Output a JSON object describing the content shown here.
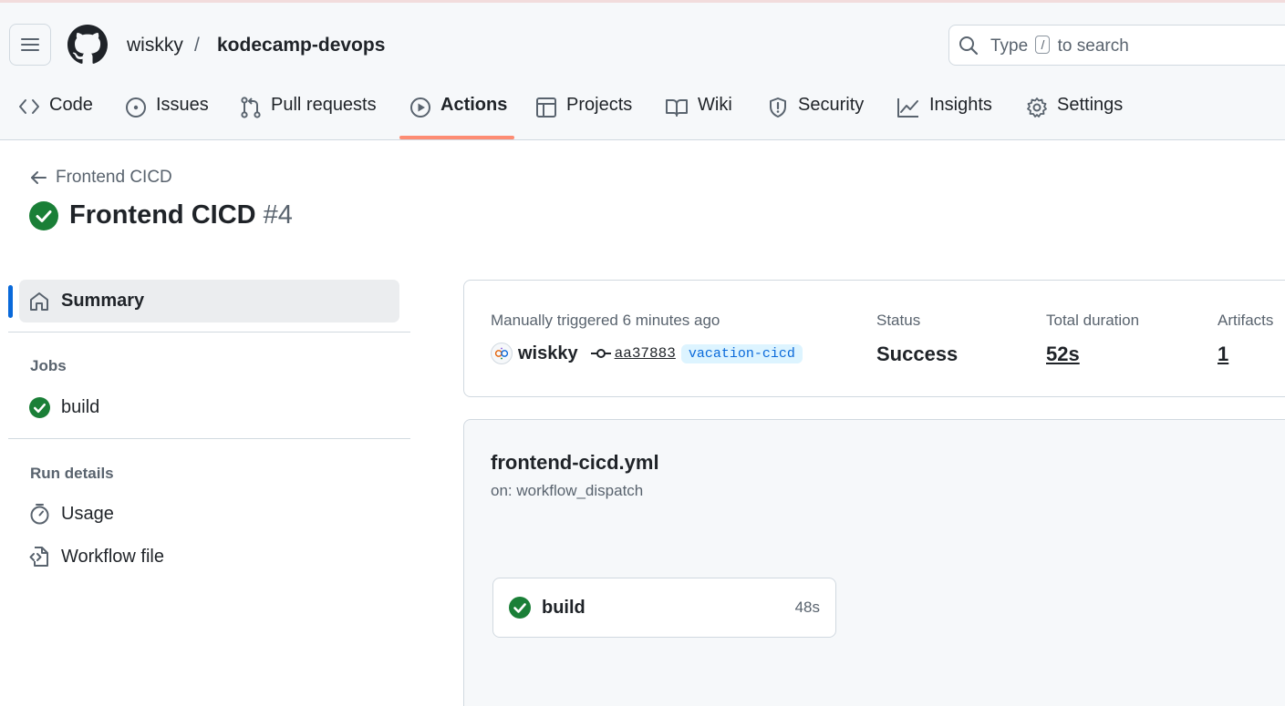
{
  "header": {
    "owner": "wiskky",
    "separator": "/",
    "repo": "kodecamp-devops",
    "search": {
      "prefix": "Type",
      "key": "/",
      "suffix": "to search"
    }
  },
  "tabs": [
    {
      "label": "Code",
      "icon": "code-icon"
    },
    {
      "label": "Issues",
      "icon": "issue-icon"
    },
    {
      "label": "Pull requests",
      "icon": "pull-request-icon"
    },
    {
      "label": "Actions",
      "icon": "play-icon",
      "active": true
    },
    {
      "label": "Projects",
      "icon": "table-icon"
    },
    {
      "label": "Wiki",
      "icon": "book-icon"
    },
    {
      "label": "Security",
      "icon": "shield-icon"
    },
    {
      "label": "Insights",
      "icon": "graph-icon"
    },
    {
      "label": "Settings",
      "icon": "gear-icon"
    }
  ],
  "run": {
    "back_label": "Frontend CICD",
    "title": "Frontend CICD",
    "number": "#4",
    "status_icon": "check-circle-icon"
  },
  "sidebar": {
    "summary_label": "Summary",
    "jobs_heading": "Jobs",
    "jobs": [
      {
        "label": "build",
        "status": "success"
      }
    ],
    "run_details_heading": "Run details",
    "details": [
      {
        "label": "Usage",
        "icon": "stopwatch-icon"
      },
      {
        "label": "Workflow file",
        "icon": "file-code-icon"
      }
    ]
  },
  "summary": {
    "trigger_text": "Manually triggered 6 minutes ago",
    "actor": "wiskky",
    "commit_sha": "aa37883",
    "branch": "vacation-cicd",
    "status_label": "Status",
    "status_value": "Success",
    "duration_label": "Total duration",
    "duration_value": "52s",
    "artifacts_label": "Artifacts",
    "artifacts_value": "1"
  },
  "workflow": {
    "file": "frontend-cicd.yml",
    "trigger": "on: workflow_dispatch",
    "jobs": [
      {
        "name": "build",
        "duration": "48s",
        "status": "success"
      }
    ]
  },
  "colors": {
    "success": "#1a7f37",
    "accent": "#0969da",
    "tab_underline": "#fd8c73",
    "muted_text": "#59636e"
  }
}
